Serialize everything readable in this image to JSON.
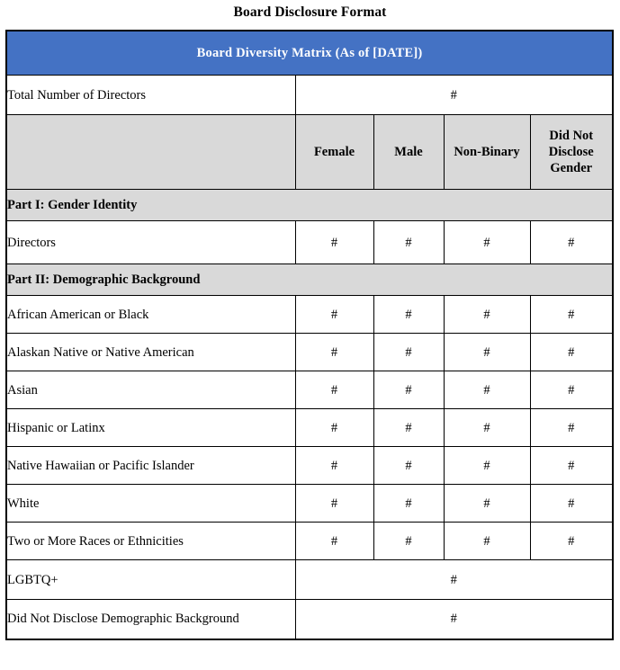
{
  "document": {
    "title": "Board Disclosure Format"
  },
  "table": {
    "caption": "Board Diversity Matrix (As of [DATE])",
    "accent_color": "#4472C4",
    "header_fill": "#D9D9D9",
    "total_row": {
      "label": "Total Number of Directors",
      "value": "#"
    },
    "gender_columns": [
      "Female",
      "Male",
      "Non-Binary",
      "Did Not Disclose Gender"
    ],
    "sections": [
      {
        "heading": "Part I: Gender Identity",
        "rows": [
          {
            "label": "Directors",
            "indent": "l1",
            "values": [
              "#",
              "#",
              "#",
              "#"
            ]
          }
        ]
      },
      {
        "heading": "Part II: Demographic Background",
        "rows": [
          {
            "label": "African American or Black",
            "indent": "l2",
            "values": [
              "#",
              "#",
              "#",
              "#"
            ]
          },
          {
            "label": "Alaskan Native or Native American",
            "indent": "l2",
            "values": [
              "#",
              "#",
              "#",
              "#"
            ]
          },
          {
            "label": "Asian",
            "indent": "l2",
            "values": [
              "#",
              "#",
              "#",
              "#"
            ]
          },
          {
            "label": "Hispanic or Latinx",
            "indent": "l2",
            "values": [
              "#",
              "#",
              "#",
              "#"
            ]
          },
          {
            "label": "Native Hawaiian or Pacific Islander",
            "indent": "l2",
            "values": [
              "#",
              "#",
              "#",
              "#"
            ]
          },
          {
            "label": "White",
            "indent": "l2",
            "values": [
              "#",
              "#",
              "#",
              "#"
            ]
          },
          {
            "label": "Two or More Races or Ethnicities",
            "indent": "l2",
            "values": [
              "#",
              "#",
              "#",
              "#"
            ]
          }
        ]
      }
    ],
    "wide_rows": [
      {
        "label": "LGBTQ+",
        "indent": "lgbtq",
        "value": "#"
      },
      {
        "label": "Did Not Disclose Demographic Background",
        "indent": "l2",
        "value": "#"
      }
    ]
  }
}
